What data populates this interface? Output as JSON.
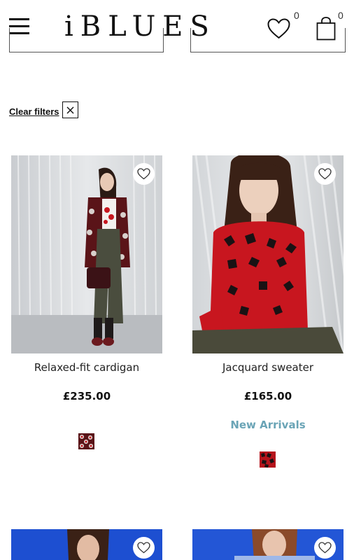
{
  "header": {
    "brand": "iBLUES",
    "wishlist_count": "0",
    "bag_count": "0"
  },
  "filters": {
    "clear_label": "Clear filters"
  },
  "products": [
    {
      "name": "Relaxed-fit cardigan",
      "price": "£235.00",
      "badge": ""
    },
    {
      "name": "Jacquard sweater",
      "price": "£165.00",
      "badge": "New Arrivals"
    }
  ],
  "icons": {
    "menu": "hamburger-menu-icon",
    "wishlist": "heart-icon",
    "bag": "shopping-bag-icon",
    "clear": "close-icon",
    "favorite": "heart-icon"
  },
  "colors": {
    "badge": "#6aa4b6",
    "text": "#111111",
    "second_row_background": "#1d4fd1"
  }
}
